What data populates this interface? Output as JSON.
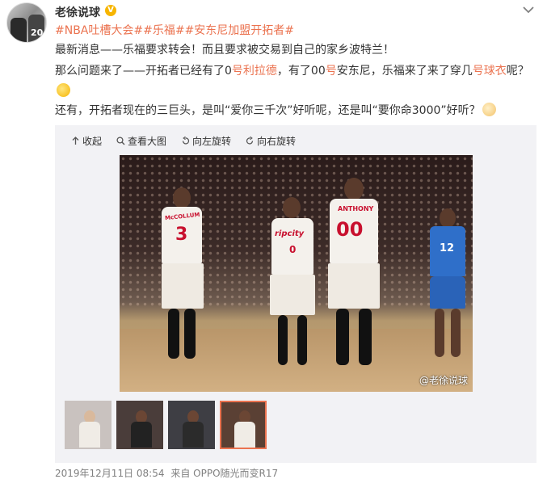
{
  "user": {
    "name": "老徐说球",
    "badge": "V"
  },
  "post": {
    "tags": "#NBA吐槽大会##乐福##安东尼加盟开拓者#",
    "line1": "最新消息——乐福要求转会！而且要求被交易到自己的家乡波特兰！",
    "line2_a": "那么问题来了——开拓者已经有了0",
    "line2_b": "号利拉德",
    "line2_c": "，有了00",
    "line2_d": "号",
    "line2_e": "安东尼，乐福来了来了穿几",
    "line2_f": "号球衣",
    "line2_g": "呢？",
    "line4": "还有，开拓者现在的三巨头，是叫“爱你三千次”好听呢，还是叫“要你命3000”好听？"
  },
  "toolbar": {
    "collapse": "收起",
    "view_large": "查看大图",
    "rotate_left": "向左旋转",
    "rotate_right": "向右旋转"
  },
  "photo": {
    "watermark": "@老徐说球",
    "jersey_numbers": [
      "3",
      "0",
      "00",
      "12"
    ],
    "jersey_names": [
      "McCOLLUM",
      "ANTHONY"
    ],
    "jersey_brand": "ripcity"
  },
  "footer": {
    "timestamp": "2019年12月11日 08:54",
    "source_prefix": "来自",
    "source": "OPPO随光而变R17"
  },
  "colors": {
    "accent": "#eb7350",
    "badge": "#f7b500",
    "meta": "#808080"
  }
}
